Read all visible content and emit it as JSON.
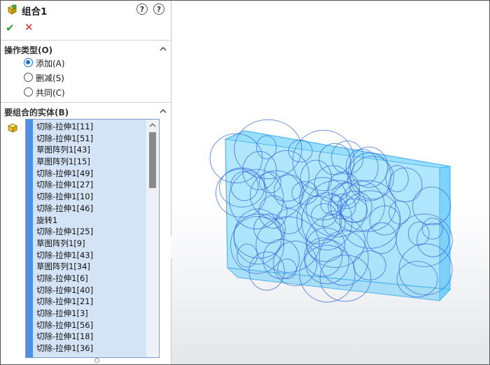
{
  "panel": {
    "title": "组合1",
    "help_label": "?",
    "ok_icon": "checkmark-icon",
    "cancel_icon": "x-icon",
    "ok_glyph": "✔",
    "cancel_glyph": "✕"
  },
  "operation_type": {
    "title": "操作类型(O)",
    "options": [
      {
        "label": "添加(A)",
        "selected": true
      },
      {
        "label": "删减(S)",
        "selected": false
      },
      {
        "label": "共同(C)",
        "selected": false
      }
    ]
  },
  "bodies": {
    "title": "要组合的实体(B)",
    "items": [
      "切除-拉伸1[11]",
      "切除-拉伸1[51]",
      "草图阵列1[43]",
      "草图阵列1[15]",
      "切除-拉伸1[49]",
      "切除-拉伸1[27]",
      "切除-拉伸1[10]",
      "切除-拉伸1[46]",
      "旋转1",
      "切除-拉伸1[25]",
      "草图阵列1[9]",
      "切除-拉伸1[43]",
      "草图阵列1[34]",
      "切除-拉伸1[6]",
      "切除-拉伸1[40]",
      "切除-拉伸1[21]",
      "切除-拉伸1[3]",
      "切除-拉伸1[56]",
      "切除-拉伸1[18]",
      "切除-拉伸1[36]"
    ]
  },
  "colors": {
    "accent": "#1b70c9",
    "list_bg": "#d4e3f6",
    "model_fill": "#6fd3ff",
    "model_edge": "#3a6fd8"
  }
}
